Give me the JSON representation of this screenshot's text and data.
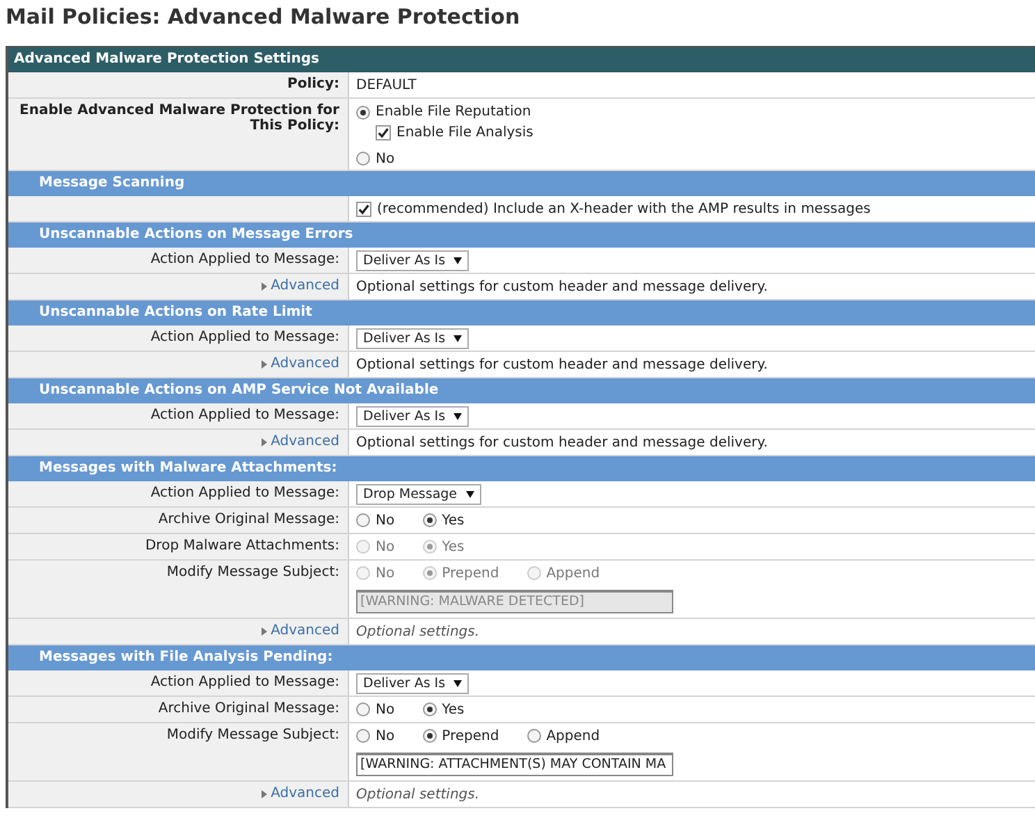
{
  "page": {
    "title": "Mail Policies: Advanced Malware Protection"
  },
  "sections": [
    {
      "title": "Advanced Malware Protection Settings",
      "kind": "dark",
      "rows": [
        {
          "label": "Policy:",
          "lines": [
            [
              {
                "kind": "text",
                "text": "DEFAULT"
              }
            ]
          ]
        },
        {
          "label": "Enable Advanced Malware Protection for This Policy:",
          "lines": [
            [
              {
                "kind": "radio",
                "text": "Enable File Reputation",
                "selected": true,
                "disabled": false,
                "children": [
                  {
                    "kind": "checkbox",
                    "text": "Enable File Analysis",
                    "checked": true
                  }
                ]
              }
            ],
            [
              {
                "kind": "radio",
                "text": "No",
                "selected": false,
                "disabled": false
              }
            ]
          ]
        }
      ]
    },
    {
      "title": "Message Scanning",
      "kind": "blue",
      "rows": [
        {
          "lines": [
            [
              {
                "kind": "checkbox",
                "text": "(recommended) Include an X-header with the AMP results in messages",
                "checked": true
              }
            ]
          ]
        }
      ]
    },
    {
      "title": "Unscannable Actions on Message Errors",
      "kind": "blue",
      "rows": [
        {
          "label": "Action Applied to Message:",
          "lines": [
            [
              {
                "kind": "select",
                "text": "Deliver As Is"
              }
            ]
          ]
        },
        {
          "link": "Advanced",
          "lines": [
            [
              {
                "kind": "note",
                "text": "Optional settings for custom header and message delivery.",
                "italic": false
              }
            ]
          ]
        }
      ]
    },
    {
      "title": "Unscannable Actions on Rate Limit",
      "kind": "blue",
      "rows": [
        {
          "label": "Action Applied to Message:",
          "lines": [
            [
              {
                "kind": "select",
                "text": "Deliver As Is"
              }
            ]
          ]
        },
        {
          "link": "Advanced",
          "lines": [
            [
              {
                "kind": "note",
                "text": "Optional settings for custom header and message delivery.",
                "italic": false
              }
            ]
          ]
        }
      ]
    },
    {
      "title": "Unscannable Actions on AMP Service Not Available",
      "kind": "blue",
      "rows": [
        {
          "label": "Action Applied to Message:",
          "lines": [
            [
              {
                "kind": "select",
                "text": "Deliver As Is"
              }
            ]
          ]
        },
        {
          "link": "Advanced",
          "lines": [
            [
              {
                "kind": "note",
                "text": "Optional settings for custom header and message delivery.",
                "italic": false
              }
            ]
          ]
        }
      ]
    },
    {
      "title": "Messages with Malware Attachments:",
      "kind": "blue",
      "rows": [
        {
          "label": "Action Applied to Message:",
          "lines": [
            [
              {
                "kind": "select",
                "text": "Drop Message"
              }
            ]
          ]
        },
        {
          "label": "Archive Original Message:",
          "lines": [
            [
              {
                "kind": "radio",
                "text": "No",
                "selected": false,
                "disabled": false
              },
              {
                "kind": "radio",
                "text": "Yes",
                "selected": true,
                "disabled": false
              }
            ]
          ]
        },
        {
          "label": "Drop Malware Attachments:",
          "lines": [
            [
              {
                "kind": "radio",
                "text": "No",
                "selected": false,
                "disabled": true
              },
              {
                "kind": "radio",
                "text": "Yes",
                "selected": true,
                "disabled": true
              }
            ]
          ]
        },
        {
          "label": "Modify Message Subject:",
          "lines": [
            [
              {
                "kind": "radio",
                "text": "No",
                "selected": false,
                "disabled": true
              },
              {
                "kind": "radio",
                "text": "Prepend",
                "selected": true,
                "disabled": true
              },
              {
                "kind": "radio",
                "text": "Append",
                "selected": false,
                "disabled": true
              }
            ],
            [
              {
                "kind": "field",
                "text": "[WARNING: MALWARE DETECTED]",
                "disabled": true
              }
            ]
          ]
        },
        {
          "link": "Advanced",
          "lines": [
            [
              {
                "kind": "note",
                "text": "Optional settings.",
                "italic": true
              }
            ]
          ]
        }
      ]
    },
    {
      "title": "Messages with File Analysis Pending:",
      "kind": "blue",
      "rows": [
        {
          "label": "Action Applied to Message:",
          "lines": [
            [
              {
                "kind": "select",
                "text": "Deliver As Is"
              }
            ]
          ]
        },
        {
          "label": "Archive Original Message:",
          "lines": [
            [
              {
                "kind": "radio",
                "text": "No",
                "selected": false,
                "disabled": false
              },
              {
                "kind": "radio",
                "text": "Yes",
                "selected": true,
                "disabled": false
              }
            ]
          ]
        },
        {
          "label": "Modify Message Subject:",
          "lines": [
            [
              {
                "kind": "radio",
                "text": "No",
                "selected": false,
                "disabled": false
              },
              {
                "kind": "radio",
                "text": "Prepend",
                "selected": true,
                "disabled": false
              },
              {
                "kind": "radio",
                "text": "Append",
                "selected": false,
                "disabled": false
              }
            ],
            [
              {
                "kind": "field",
                "text": "[WARNING: ATTACHMENT(S) MAY CONTAIN MA",
                "disabled": false
              }
            ]
          ]
        },
        {
          "link": "Advanced",
          "lines": [
            [
              {
                "kind": "note",
                "text": "Optional settings.",
                "italic": true
              }
            ]
          ]
        }
      ]
    }
  ]
}
